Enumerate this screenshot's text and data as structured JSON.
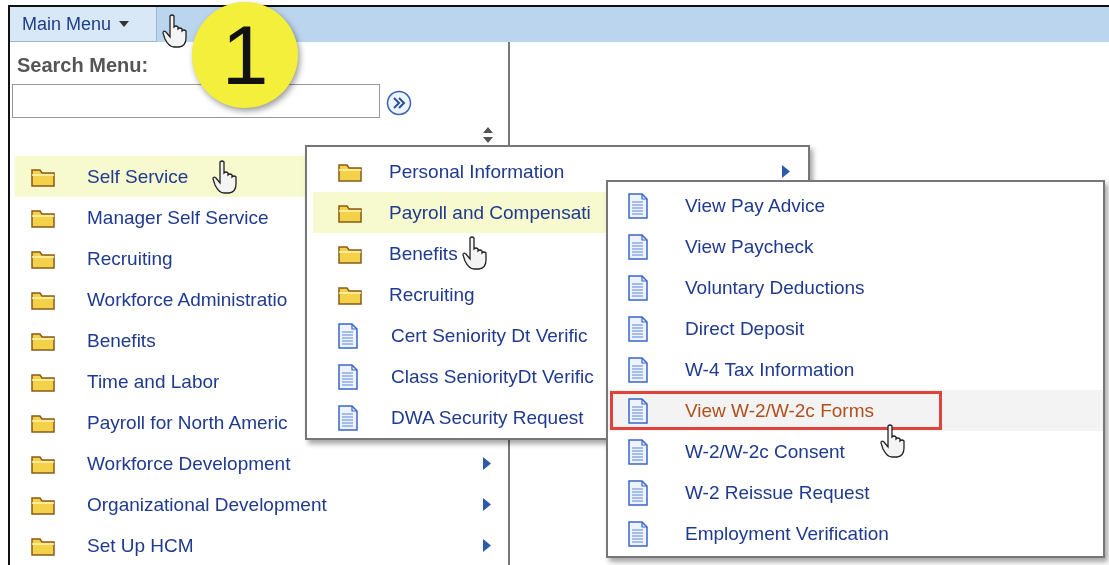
{
  "top_bar": {
    "menu_button": "Main Menu"
  },
  "search": {
    "label": "Search Menu:"
  },
  "step_badge": "1",
  "menu": {
    "items": [
      {
        "label": "Self Service",
        "kind": "folder",
        "selected": true,
        "children": [
          {
            "label": "Personal Information",
            "kind": "folder",
            "selected": false,
            "has_arrow": true
          },
          {
            "label": "Payroll and Compensati",
            "kind": "folder",
            "selected": true,
            "children": [
              {
                "label": "View Pay Advice",
                "kind": "page",
                "selected": false
              },
              {
                "label": "View Paycheck",
                "kind": "page",
                "selected": false
              },
              {
                "label": "Voluntary Deductions",
                "kind": "page",
                "selected": false
              },
              {
                "label": "Direct Deposit",
                "kind": "page",
                "selected": false
              },
              {
                "label": "W-4 Tax Information",
                "kind": "page",
                "selected": false
              },
              {
                "label": "View W-2/W-2c Forms",
                "kind": "page",
                "selected": true,
                "callout": true
              },
              {
                "label": "W-2/W-2c Consent",
                "kind": "page",
                "selected": false
              },
              {
                "label": "W-2 Reissue Request",
                "kind": "page",
                "selected": false
              },
              {
                "label": "Employment Verification",
                "kind": "page",
                "selected": false
              }
            ]
          },
          {
            "label": "Benefits",
            "kind": "folder",
            "selected": false
          },
          {
            "label": "Recruiting",
            "kind": "folder",
            "selected": false
          },
          {
            "label": "Cert Seniority Dt Verific",
            "kind": "page",
            "selected": false
          },
          {
            "label": "Class SeniorityDt Verific",
            "kind": "page",
            "selected": false
          },
          {
            "label": "DWA Security Request",
            "kind": "page",
            "selected": false
          }
        ]
      },
      {
        "label": "Manager Self Service",
        "kind": "folder",
        "selected": false
      },
      {
        "label": "Recruiting",
        "kind": "folder",
        "selected": false
      },
      {
        "label": "Workforce Administratio",
        "kind": "folder",
        "selected": false
      },
      {
        "label": "Benefits",
        "kind": "folder",
        "selected": false
      },
      {
        "label": "Time and Labor",
        "kind": "folder",
        "selected": false
      },
      {
        "label": "Payroll for North Americ",
        "kind": "folder",
        "selected": false
      },
      {
        "label": "Workforce Development",
        "kind": "folder",
        "selected": false,
        "has_arrow": true
      },
      {
        "label": "Organizational Development",
        "kind": "folder",
        "selected": false,
        "has_arrow": true
      },
      {
        "label": "Set Up HCM",
        "kind": "folder",
        "selected": false,
        "has_arrow": true
      }
    ]
  }
}
